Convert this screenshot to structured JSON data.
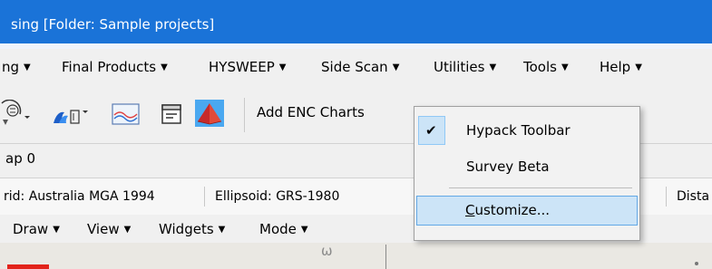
{
  "window": {
    "title": "sing  [Folder: Sample projects]"
  },
  "menubar": {
    "items": [
      {
        "label": "ng"
      },
      {
        "label": "Final Products"
      },
      {
        "label": "HYSWEEP"
      },
      {
        "label": "Side Scan"
      },
      {
        "label": "Utilities"
      },
      {
        "label": "Tools"
      },
      {
        "label": "Help"
      }
    ]
  },
  "toolbar": {
    "add_enc_label": "Add ENC Charts"
  },
  "tabs": {
    "label": "ap 0"
  },
  "status": {
    "grid": "rid: Australia MGA 1994",
    "ellipsoid": "Ellipsoid: GRS-1980",
    "distance": "Dista"
  },
  "menu2": {
    "items": [
      {
        "label": "Draw"
      },
      {
        "label": "View"
      },
      {
        "label": "Widgets"
      },
      {
        "label": "Mode"
      }
    ]
  },
  "map": {
    "mark": "ω"
  },
  "context_menu": {
    "items": [
      {
        "label": "Hypack Toolbar",
        "checked": true
      },
      {
        "label": "Survey Beta",
        "checked": false
      },
      {
        "label": "Customize...",
        "accelerator": "C",
        "highlighted": true
      }
    ]
  },
  "icons": {
    "dropdown": "caret-down",
    "check": "checkmark-icon"
  },
  "colors": {
    "titlebar": "#1a73d8",
    "highlight": "#cce4f7",
    "highlight_border": "#62a8e6",
    "accent_red": "#e2231a"
  }
}
